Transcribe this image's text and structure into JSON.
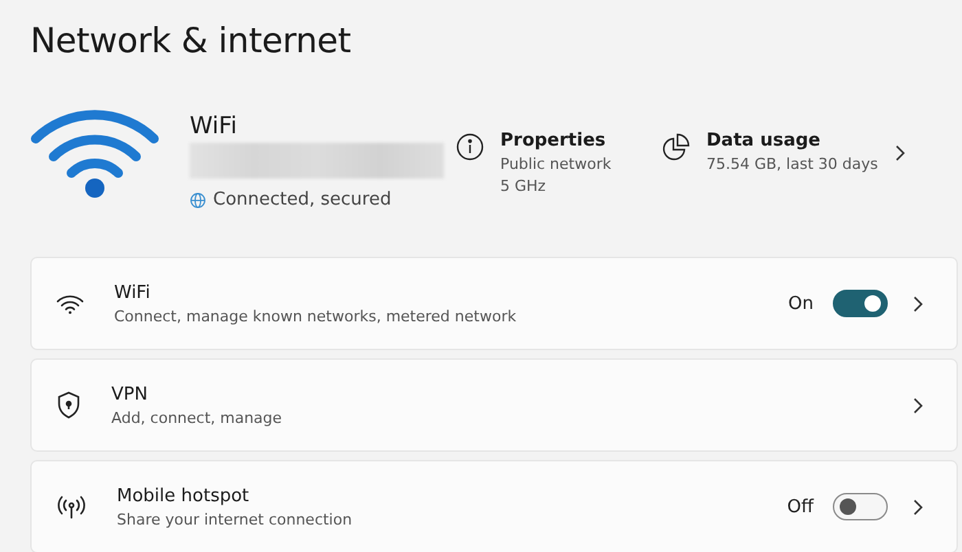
{
  "page_title": "Network & internet",
  "connection": {
    "name": "WiFi",
    "status": "Connected, secured"
  },
  "properties": {
    "title": "Properties",
    "lines": [
      "Public network",
      "5 GHz"
    ]
  },
  "data_usage": {
    "title": "Data usage",
    "detail": "75.54 GB, last 30 days"
  },
  "settings": [
    {
      "kind": "toggle",
      "title": "WiFi",
      "subtitle": "Connect, manage known networks, metered network",
      "status": "On",
      "on": true
    },
    {
      "kind": "link",
      "title": "VPN",
      "subtitle": "Add, connect, manage"
    },
    {
      "kind": "toggle",
      "title": "Mobile hotspot",
      "subtitle": "Share your internet connection",
      "status": "Off",
      "on": false
    }
  ]
}
